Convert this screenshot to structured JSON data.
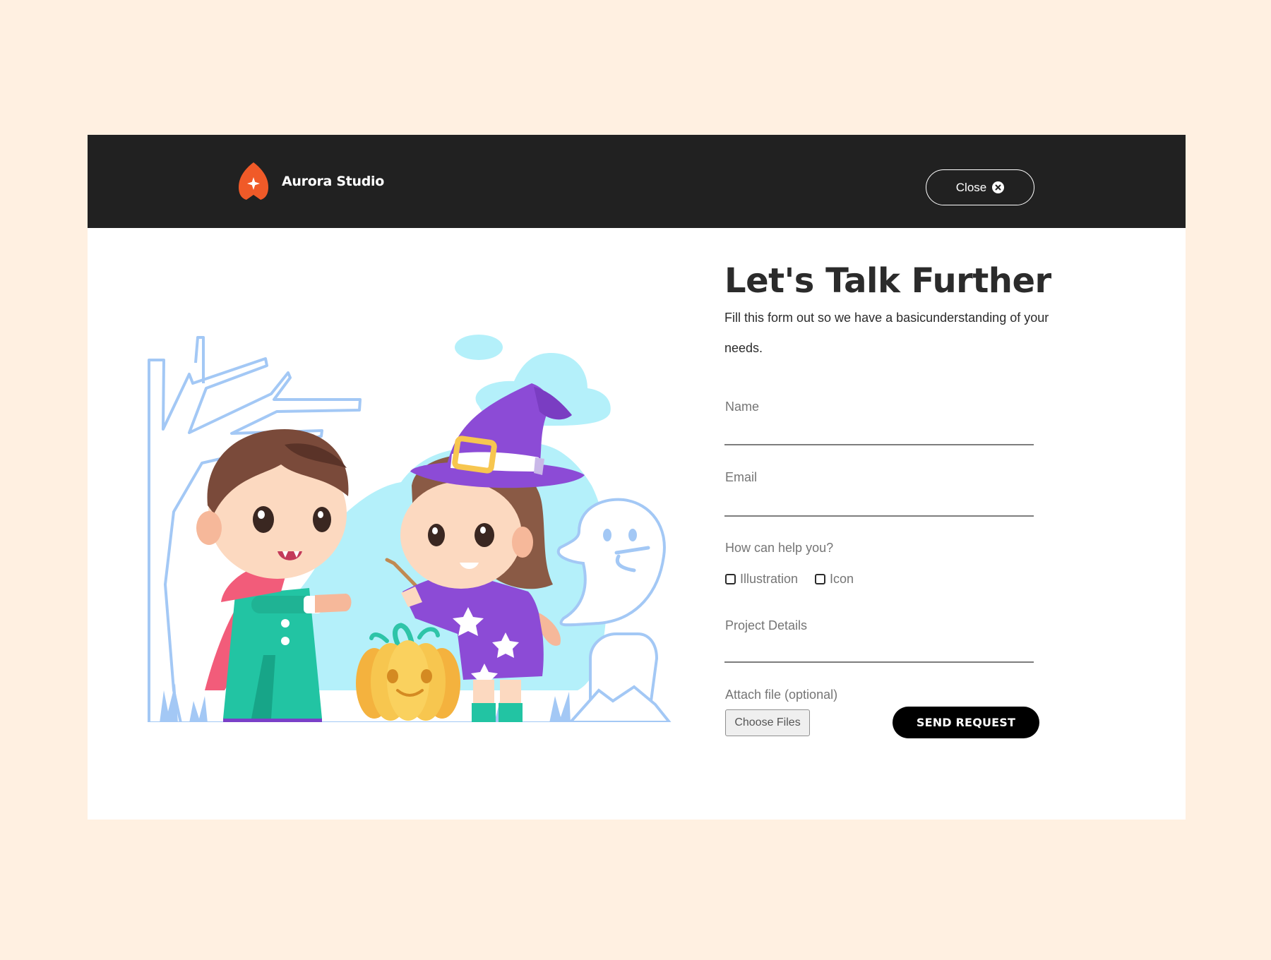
{
  "header": {
    "brand_name": "Aurora Studio",
    "close_label": "Close",
    "logo_icon": "flame-star-icon",
    "close_icon": "close-circle-icon"
  },
  "illustration": {
    "subject": "halloween-kids-illustration"
  },
  "form": {
    "title": "Let's Talk Further",
    "subtitle": "Fill this form out so we have a basicunderstanding of your needs.",
    "fields": {
      "name": {
        "label": "Name",
        "value": ""
      },
      "email": {
        "label": "Email",
        "value": ""
      },
      "help_question": "How can help you?",
      "options": [
        {
          "label": "Illustration",
          "checked": false
        },
        {
          "label": "Icon",
          "checked": false
        }
      ],
      "project_details": {
        "label": "Project Details",
        "value": ""
      },
      "attach_label": "Attach file (optional)",
      "choose_files_label": "Choose Files"
    },
    "submit_label": "SEND REQUEST"
  },
  "colors": {
    "page_background": "#fff0e1",
    "header_background": "#212121",
    "brand_accent": "#f05a28",
    "illustration_blue": "#a3c8f5",
    "illustration_cyan": "#b4f0fa",
    "witch_purple": "#8c4bd6"
  }
}
